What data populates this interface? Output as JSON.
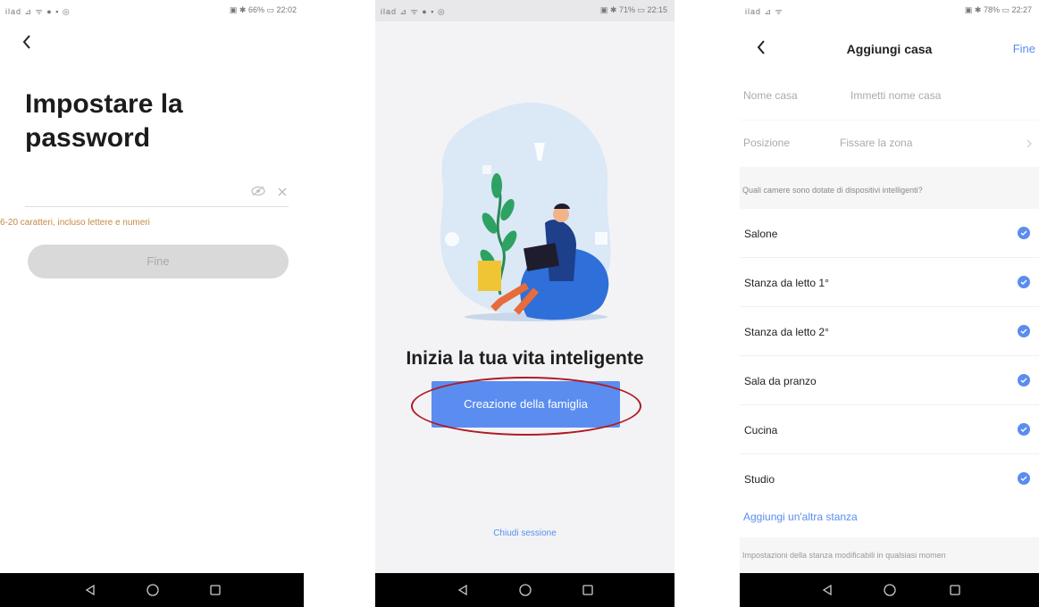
{
  "screen1": {
    "status_left": "ilad ⊿ ᯤ ● ▪ ◎",
    "status_right": "▣ ✱ 66% ▭ 22:02",
    "title": "Impostare la password",
    "hint": "6-20 caratteri, incluso lettere e numeri",
    "button": "Fine"
  },
  "screen2": {
    "status_left": "ilad ⊿ ᯤ ● ▪ ◎",
    "status_right": "▣ ✱ 71% ▭ 22:15",
    "headline": "Inizia la tua vita inteligente",
    "button": "Creazione della famiglia",
    "logout": "Chiudi sessione",
    "annotation_color": "#b01b23"
  },
  "screen3": {
    "status_left": "ilad ⊿ ᯤ",
    "status_right": "▣ ✱ 78% ▭ 22:27",
    "title": "Aggiungi casa",
    "done": "Fine",
    "home_name_label": "Nome casa",
    "home_name_placeholder": "Immetti nome casa",
    "position_label": "Posizione",
    "position_value": "Fissare la zona",
    "section_header": "Quali camere sono dotate di dispositivi intelligenti?",
    "rooms": [
      {
        "label": "Salone",
        "checked": true
      },
      {
        "label": "Stanza da letto 1°",
        "checked": true
      },
      {
        "label": "Stanza da letto 2°",
        "checked": true
      },
      {
        "label": "Sala da pranzo",
        "checked": true
      },
      {
        "label": "Cucina",
        "checked": true
      },
      {
        "label": "Studio",
        "checked": true
      }
    ],
    "add_room": "Aggiungi un'altra stanza",
    "note": "Impostazioni della stanza modificabili in qualsiasi momen"
  },
  "colors": {
    "accent": "#5a8def",
    "hint": "#c58a44",
    "navbar": "#000000"
  }
}
